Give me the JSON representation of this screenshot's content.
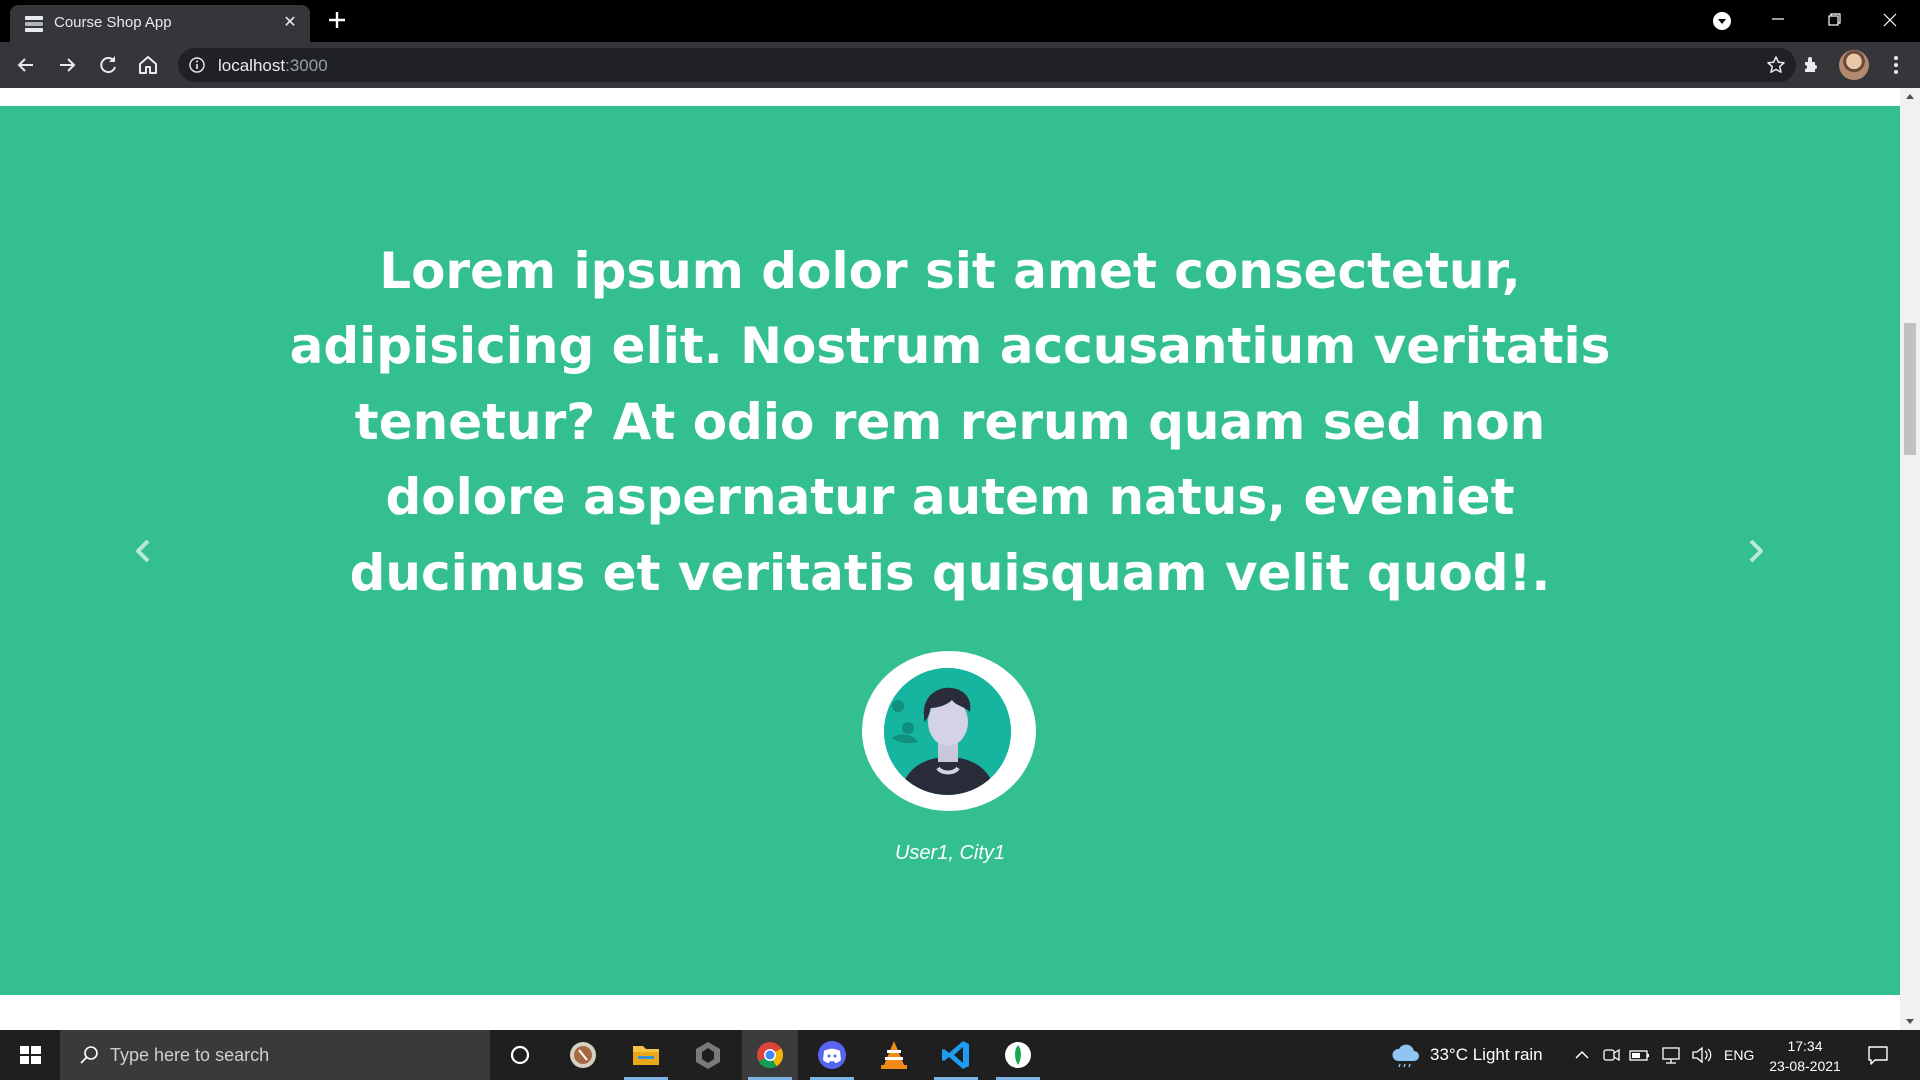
{
  "browser": {
    "tab_title": "Course Shop App",
    "url_host": "localhost",
    "url_port": ":3000"
  },
  "testimonial": {
    "quote": "Lorem ipsum dolor sit amet consectetur, adipisicing elit. Nostrum accusantium veritatis tenetur? At odio rem rerum quam sed non dolore aspernatur autem natus, eveniet ducimus et veritatis quisquam velit quod!.",
    "author": "User1, City1",
    "background_color": "#33bf8f"
  },
  "taskbar": {
    "search_placeholder": "Type here to search",
    "weather": "33°C  Light rain",
    "language": "ENG",
    "time": "17:34",
    "date": "23-08-2021",
    "apps": [
      "cortana-icon",
      "app-icon",
      "file-explorer-icon",
      "unity-icon",
      "chrome-icon",
      "discord-icon",
      "vlc-icon",
      "vscode-icon",
      "mongodb-compass-icon"
    ]
  }
}
